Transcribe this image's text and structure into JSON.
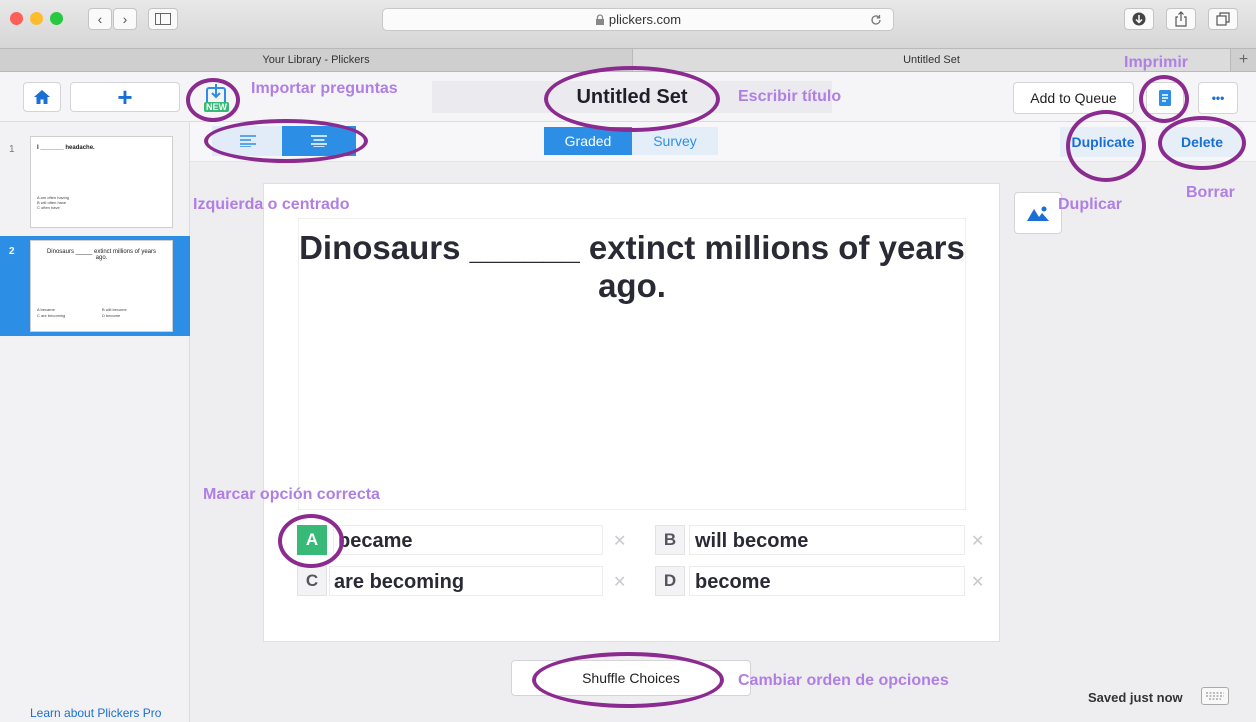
{
  "browser": {
    "url": "plickers.com",
    "tabs": [
      "Your Library - Plickers",
      "Untitled Set"
    ],
    "new_tab": "+"
  },
  "toolbar": {
    "home_icon": "home-icon",
    "add": "+",
    "import_badge": "NEW",
    "title": "Untitled Set",
    "add_to_queue": "Add to Queue",
    "more": "•••"
  },
  "subbar": {
    "graded": "Graded",
    "survey": "Survey",
    "duplicate": "Duplicate",
    "delete": "Delete"
  },
  "sidebar": {
    "items": [
      {
        "number": "1",
        "question": "I _______ headache.",
        "choices": [
          "A  am often having",
          "B  will often have",
          "C  often have"
        ]
      },
      {
        "number": "2",
        "question": "Dinosaurs _____ extinct millions of years ago.",
        "choices": [
          "A  became",
          "B  will become",
          "C  are becoming",
          "D  become"
        ]
      }
    ],
    "learn_more": "Learn about Plickers Pro"
  },
  "question": {
    "text": "Dinosaurs ______ extinct millions of years ago.",
    "choices": [
      {
        "letter": "A",
        "text": "became",
        "correct": true
      },
      {
        "letter": "B",
        "text": "will become",
        "correct": false
      },
      {
        "letter": "C",
        "text": "are becoming",
        "correct": false
      },
      {
        "letter": "D",
        "text": "become",
        "correct": false
      }
    ]
  },
  "footer": {
    "shuffle": "Shuffle Choices",
    "saved": "Saved just now"
  },
  "annotations": {
    "importar": "Importar preguntas",
    "titulo": "Escribir título",
    "imprimir": "Imprimir",
    "alineacion": "Izquierda o centrado",
    "duplicar": "Duplicar",
    "borrar": "Borrar",
    "marcar": "Marcar opción correcta",
    "cambiar": "Cambiar orden de opciones"
  },
  "colors": {
    "accent": "#2d8ee6",
    "correct": "#39b977",
    "annotation": "#b07fe4",
    "oval": "#8b2b8f"
  }
}
